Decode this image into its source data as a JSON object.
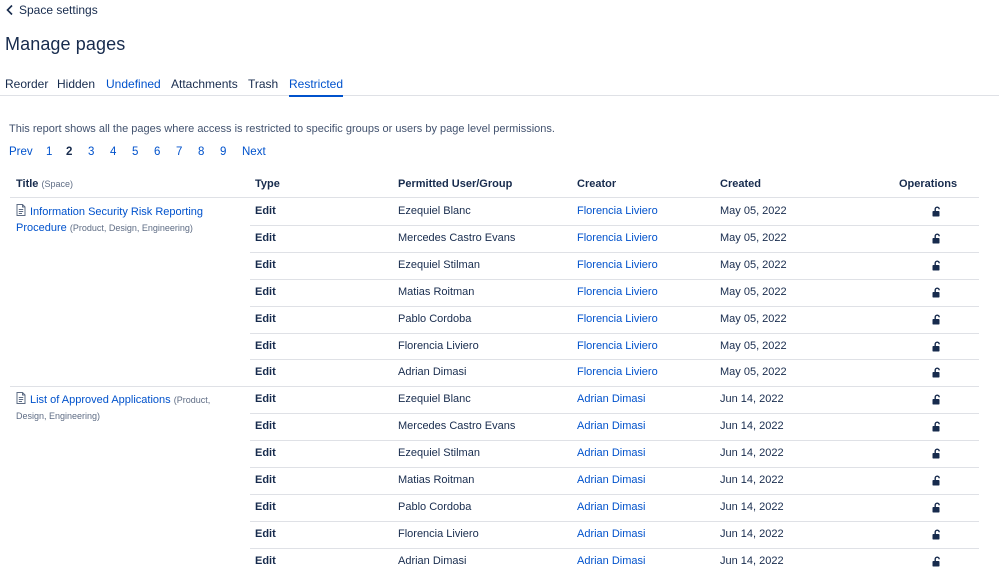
{
  "back": {
    "label": "Space settings"
  },
  "page_title": "Manage pages",
  "tabs": [
    {
      "label": "Reorder",
      "state": "normal"
    },
    {
      "label": "Hidden",
      "state": "normal"
    },
    {
      "label": "Undefined",
      "state": "link"
    },
    {
      "label": "Attachments",
      "state": "normal"
    },
    {
      "label": "Trash",
      "state": "normal"
    },
    {
      "label": "Restricted",
      "state": "active"
    }
  ],
  "description": "This report shows all the pages where access is restricted to specific groups or users by page level permissions.",
  "pagination": {
    "prev": "Prev",
    "pages": [
      "1",
      "2",
      "3",
      "4",
      "5",
      "6",
      "7",
      "8",
      "9"
    ],
    "current": "2",
    "next": "Next"
  },
  "table": {
    "headers": {
      "title": "Title",
      "title_sub": "(Space)",
      "type": "Type",
      "permitted": "Permitted User/Group",
      "creator": "Creator",
      "created": "Created",
      "operations": "Operations"
    },
    "groups": [
      {
        "title": "Information Security Risk Reporting Procedure",
        "space": "(Product, Design, Engineering)",
        "rows": [
          {
            "type": "Edit",
            "user": "Ezequiel Blanc",
            "creator": "Florencia Liviero",
            "created": "May 05, 2022"
          },
          {
            "type": "Edit",
            "user": "Mercedes Castro Evans",
            "creator": "Florencia Liviero",
            "created": "May 05, 2022"
          },
          {
            "type": "Edit",
            "user": "Ezequiel Stilman",
            "creator": "Florencia Liviero",
            "created": "May 05, 2022"
          },
          {
            "type": "Edit",
            "user": "Matias Roitman",
            "creator": "Florencia Liviero",
            "created": "May 05, 2022"
          },
          {
            "type": "Edit",
            "user": "Pablo Cordoba",
            "creator": "Florencia Liviero",
            "created": "May 05, 2022"
          },
          {
            "type": "Edit",
            "user": "Florencia Liviero",
            "creator": "Florencia Liviero",
            "created": "May 05, 2022"
          },
          {
            "type": "Edit",
            "user": "Adrian Dimasi",
            "creator": "Florencia Liviero",
            "created": "May 05, 2022"
          }
        ]
      },
      {
        "title": "List of Approved Applications",
        "space": "(Product, Design, Engineering)",
        "rows": [
          {
            "type": "Edit",
            "user": "Ezequiel Blanc",
            "creator": "Adrian Dimasi",
            "created": "Jun 14, 2022"
          },
          {
            "type": "Edit",
            "user": "Mercedes Castro Evans",
            "creator": "Adrian Dimasi",
            "created": "Jun 14, 2022"
          },
          {
            "type": "Edit",
            "user": "Ezequiel Stilman",
            "creator": "Adrian Dimasi",
            "created": "Jun 14, 2022"
          },
          {
            "type": "Edit",
            "user": "Matias Roitman",
            "creator": "Adrian Dimasi",
            "created": "Jun 14, 2022"
          },
          {
            "type": "Edit",
            "user": "Pablo Cordoba",
            "creator": "Adrian Dimasi",
            "created": "Jun 14, 2022"
          },
          {
            "type": "Edit",
            "user": "Florencia Liviero",
            "creator": "Adrian Dimasi",
            "created": "Jun 14, 2022"
          },
          {
            "type": "Edit",
            "user": "Adrian Dimasi",
            "creator": "Adrian Dimasi",
            "created": "Jun 14, 2022"
          }
        ]
      }
    ]
  },
  "icons": {
    "back": "chevron-left-icon",
    "page": "page-icon",
    "operation": "unlock-icon"
  },
  "colors": {
    "link": "#0052cc",
    "text": "#172b4d",
    "muted": "#5e6c84",
    "border": "#dfe1e6"
  }
}
